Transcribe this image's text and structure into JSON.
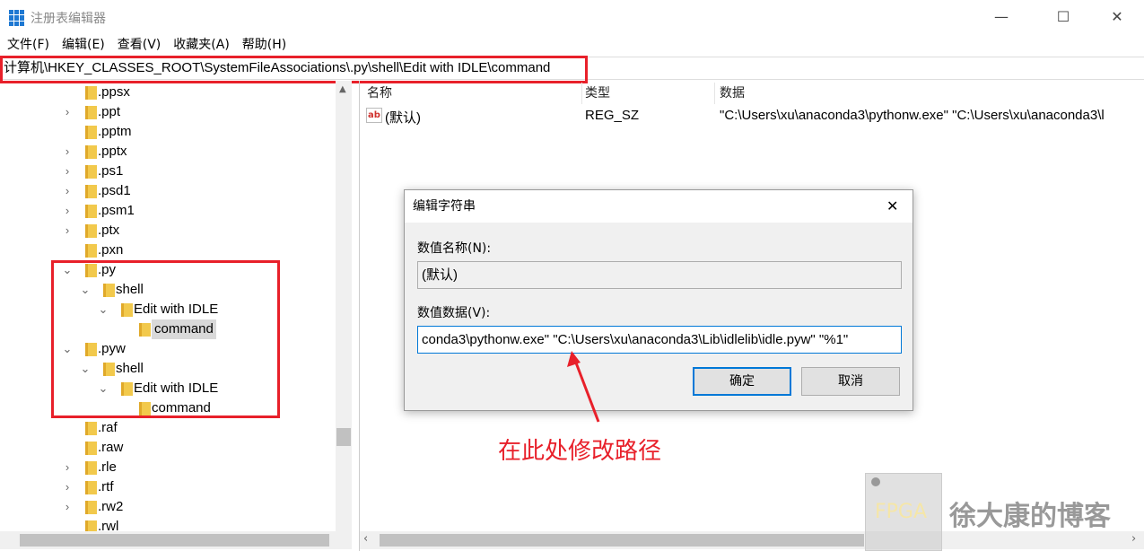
{
  "window": {
    "title": "注册表编辑器",
    "minimize": "—",
    "maximize": "☐",
    "close": "✕"
  },
  "menu": [
    "文件(F)",
    "编辑(E)",
    "查看(V)",
    "收藏夹(A)",
    "帮助(H)"
  ],
  "address": "计算机\\HKEY_CLASSES_ROOT\\SystemFileAssociations\\.py\\shell\\Edit with IDLE\\command",
  "tree": [
    {
      "label": ".ppsx",
      "level": 0,
      "chevron": ""
    },
    {
      "label": ".ppt",
      "level": 0,
      "chevron": ">"
    },
    {
      "label": ".pptm",
      "level": 0,
      "chevron": ""
    },
    {
      "label": ".pptx",
      "level": 0,
      "chevron": ">"
    },
    {
      "label": ".ps1",
      "level": 0,
      "chevron": ">"
    },
    {
      "label": ".psd1",
      "level": 0,
      "chevron": ">"
    },
    {
      "label": ".psm1",
      "level": 0,
      "chevron": ">"
    },
    {
      "label": ".ptx",
      "level": 0,
      "chevron": ">"
    },
    {
      "label": ".pxn",
      "level": 0,
      "chevron": ""
    },
    {
      "label": ".py",
      "level": 0,
      "chevron": "v"
    },
    {
      "label": "shell",
      "level": 1,
      "chevron": "v"
    },
    {
      "label": "Edit with IDLE",
      "level": 2,
      "chevron": "v"
    },
    {
      "label": "command",
      "level": 3,
      "chevron": "",
      "selected": true
    },
    {
      "label": ".pyw",
      "level": 0,
      "chevron": "v"
    },
    {
      "label": "shell",
      "level": 1,
      "chevron": "v"
    },
    {
      "label": "Edit with IDLE",
      "level": 2,
      "chevron": "v"
    },
    {
      "label": "command",
      "level": 3,
      "chevron": ""
    },
    {
      "label": ".raf",
      "level": 0,
      "chevron": ""
    },
    {
      "label": ".raw",
      "level": 0,
      "chevron": ""
    },
    {
      "label": ".rle",
      "level": 0,
      "chevron": ">"
    },
    {
      "label": ".rtf",
      "level": 0,
      "chevron": ">"
    },
    {
      "label": ".rw2",
      "level": 0,
      "chevron": ">"
    },
    {
      "label": ".rwl",
      "level": 0,
      "chevron": ""
    }
  ],
  "list": {
    "headers": [
      "名称",
      "类型",
      "数据"
    ],
    "rows": [
      {
        "name": "(默认)",
        "type": "REG_SZ",
        "data": "\"C:\\Users\\xu\\anaconda3\\pythonw.exe\" \"C:\\Users\\xu\\anaconda3\\l"
      }
    ]
  },
  "dialog": {
    "title": "编辑字符串",
    "name_label": "数值名称(N):",
    "name_value": "(默认)",
    "data_label": "数值数据(V):",
    "data_value": "conda3\\pythonw.exe\" \"C:\\Users\\xu\\anaconda3\\Lib\\idlelib\\idle.pyw\" \"%1\"",
    "ok": "确定",
    "cancel": "取消",
    "close": "✕"
  },
  "annotation": "在此处修改路径",
  "watermark": {
    "badge": "FPGA",
    "text": "徐大康的博客"
  },
  "colors": {
    "highlight": "#e8202a",
    "accent": "#0078d7"
  }
}
